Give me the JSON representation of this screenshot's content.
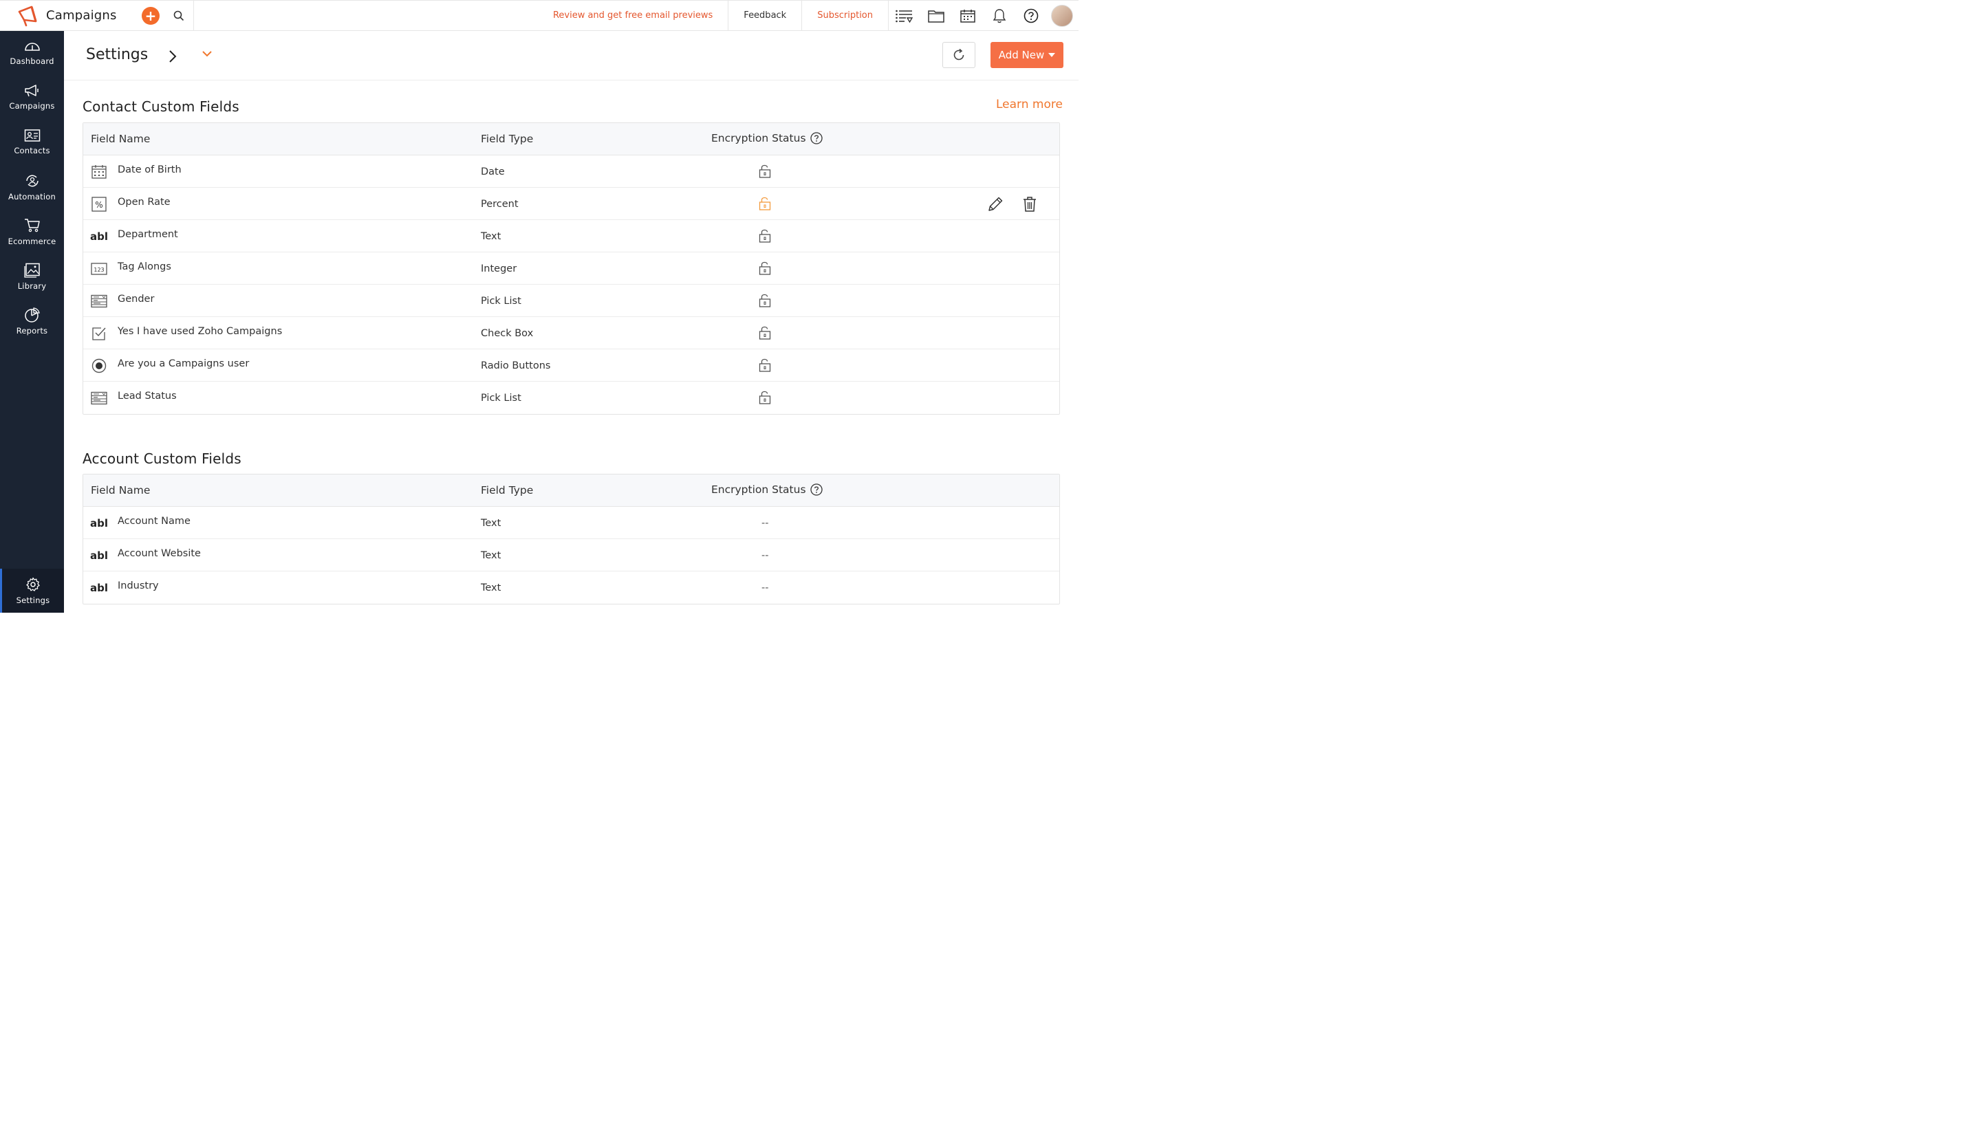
{
  "app": {
    "name": "Campaigns",
    "brand_color": "#e4572e"
  },
  "topbar": {
    "promo_link": "Review and get free email previews",
    "feedback": "Feedback",
    "subscription": "Subscription",
    "icons": [
      "plus-icon",
      "search-icon",
      "list-filter-icon",
      "folder-icon",
      "calendar-icon",
      "bell-icon",
      "help-icon",
      "avatar"
    ]
  },
  "sidebar": {
    "items": [
      {
        "label": "Dashboard",
        "icon": "gauge-icon"
      },
      {
        "label": "Campaigns",
        "icon": "megaphone-icon"
      },
      {
        "label": "Contacts",
        "icon": "contact-card-icon"
      },
      {
        "label": "Automation",
        "icon": "automation-icon"
      },
      {
        "label": "Ecommerce",
        "icon": "cart-icon"
      },
      {
        "label": "Library",
        "icon": "image-library-icon"
      },
      {
        "label": "Reports",
        "icon": "pie-chart-icon"
      }
    ],
    "settings": {
      "label": "Settings",
      "icon": "gear-icon",
      "active": true
    }
  },
  "page": {
    "title": "Settings",
    "add_new": "Add New",
    "learn_more": "Learn more"
  },
  "contact_fields": {
    "title": "Contact Custom Fields",
    "headers": {
      "name": "Field Name",
      "type": "Field Type",
      "encryption": "Encryption Status"
    },
    "rows": [
      {
        "name": "Date of Birth",
        "type": "Date",
        "icon": "calendar-field-icon",
        "lock": "unlocked"
      },
      {
        "name": "Open Rate",
        "type": "Percent",
        "icon": "percent-field-icon",
        "lock": "unlocked-highlighted"
      },
      {
        "name": "Department",
        "type": "Text",
        "icon": "text-field-icon",
        "lock": "unlocked"
      },
      {
        "name": "Tag Alongs",
        "type": "Integer",
        "icon": "integer-field-icon",
        "lock": "unlocked"
      },
      {
        "name": "Gender",
        "type": "Pick List",
        "icon": "picklist-field-icon",
        "lock": "unlocked"
      },
      {
        "name": "Yes I have used Zoho Campaigns",
        "type": "Check Box",
        "icon": "checkbox-field-icon",
        "lock": "unlocked"
      },
      {
        "name": "Are you a Campaigns user",
        "type": "Radio Buttons",
        "icon": "radio-field-icon",
        "lock": "unlocked"
      },
      {
        "name": "Lead Status",
        "type": "Pick List",
        "icon": "picklist-field-icon",
        "lock": "unlocked"
      }
    ]
  },
  "account_fields": {
    "title": "Account Custom Fields",
    "headers": {
      "name": "Field Name",
      "type": "Field Type",
      "encryption": "Encryption Status"
    },
    "abl_label": "abl",
    "rows": [
      {
        "name": "Account Name",
        "type": "Text",
        "encryption": "--"
      },
      {
        "name": "Account Website",
        "type": "Text",
        "encryption": "--"
      },
      {
        "name": "Industry",
        "type": "Text",
        "encryption": "--"
      }
    ]
  }
}
